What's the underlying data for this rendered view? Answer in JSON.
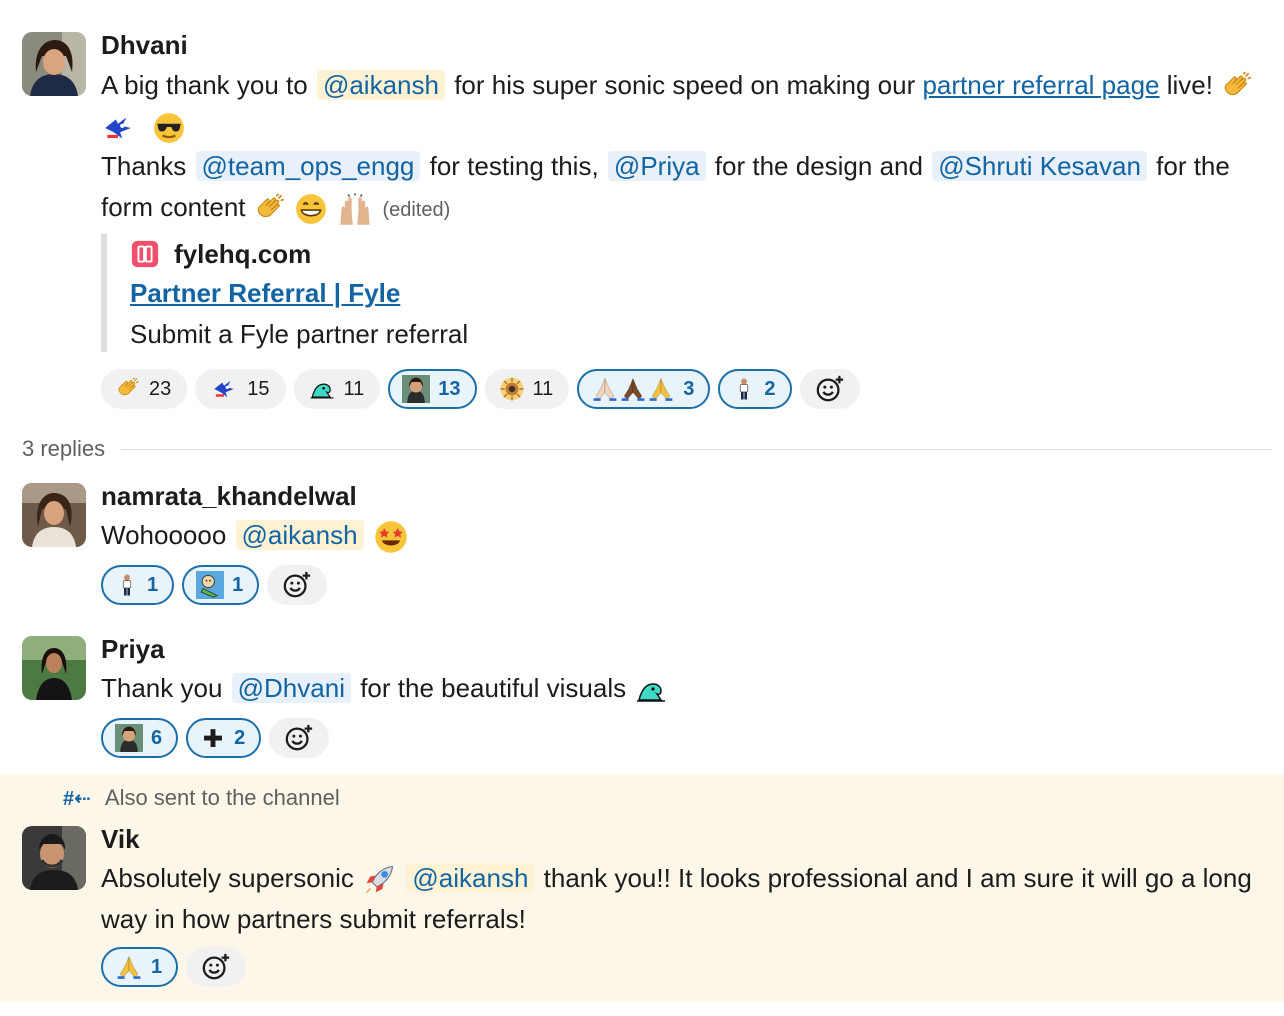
{
  "thread": {
    "parent": {
      "author": "Dhvani",
      "line1_a": "A big thank you to",
      "mention_aikansh": "@aikansh",
      "line1_b": "for his super sonic speed on making our",
      "link_text": "partner referral page",
      "line1_c": "live!",
      "line2_a": "Thanks",
      "mention_team": "@team_ops_engg",
      "line2_b": "for testing this,",
      "mention_priya": "@Priya",
      "line2_c": "for the design and",
      "mention_shruti": "@Shruti Kesavan",
      "line2_d": "for the form content",
      "edited": "(edited)",
      "attachment": {
        "site": "fylehq.com",
        "title": "Partner Referral | Fyle",
        "description": "Submit a Fyle partner referral"
      },
      "reactions": [
        {
          "icon": "clapping-hands",
          "count": "23",
          "mine": false
        },
        {
          "icon": "sonic-speed",
          "count": "15",
          "mine": false
        },
        {
          "icon": "parrot",
          "count": "11",
          "mine": false
        },
        {
          "icon": "avatar-face",
          "count": "13",
          "mine": true
        },
        {
          "icon": "star-burst",
          "count": "11",
          "mine": false
        },
        {
          "icon": "praying-hands-set",
          "count": "3",
          "mine": true
        },
        {
          "icon": "person-standing",
          "count": "2",
          "mine": true
        }
      ]
    },
    "replies_label": "3 replies",
    "replies": [
      {
        "author": "namrata_khandelwal",
        "text_a": "Wohooooo",
        "mention": "@aikansh",
        "reactions": [
          {
            "icon": "person-standing",
            "count": "1",
            "mine": true
          },
          {
            "icon": "cartoon-baby",
            "count": "1",
            "mine": true
          }
        ]
      },
      {
        "author": "Priya",
        "text_a": "Thank you",
        "mention": "@Dhvani",
        "text_b": "for the beautiful visuals",
        "reactions": [
          {
            "icon": "avatar-face",
            "count": "6",
            "mine": true
          },
          {
            "icon": "plus-sign",
            "count": "2",
            "mine": true
          }
        ]
      },
      {
        "also_sent": "Also sent to the channel",
        "author": "Vik",
        "text_a": "Absolutely supersonic",
        "mention": "@aikansh",
        "text_b": "thank you!! It looks professional and I am sure it will go a long way in how partners submit referrals!",
        "reactions": [
          {
            "icon": "praying-hands",
            "count": "1",
            "mine": true
          }
        ]
      }
    ]
  },
  "colors": {
    "link": "#1264a3",
    "mention_bg": "#fdf2d4",
    "highlight_bg": "#fcf7e8"
  }
}
